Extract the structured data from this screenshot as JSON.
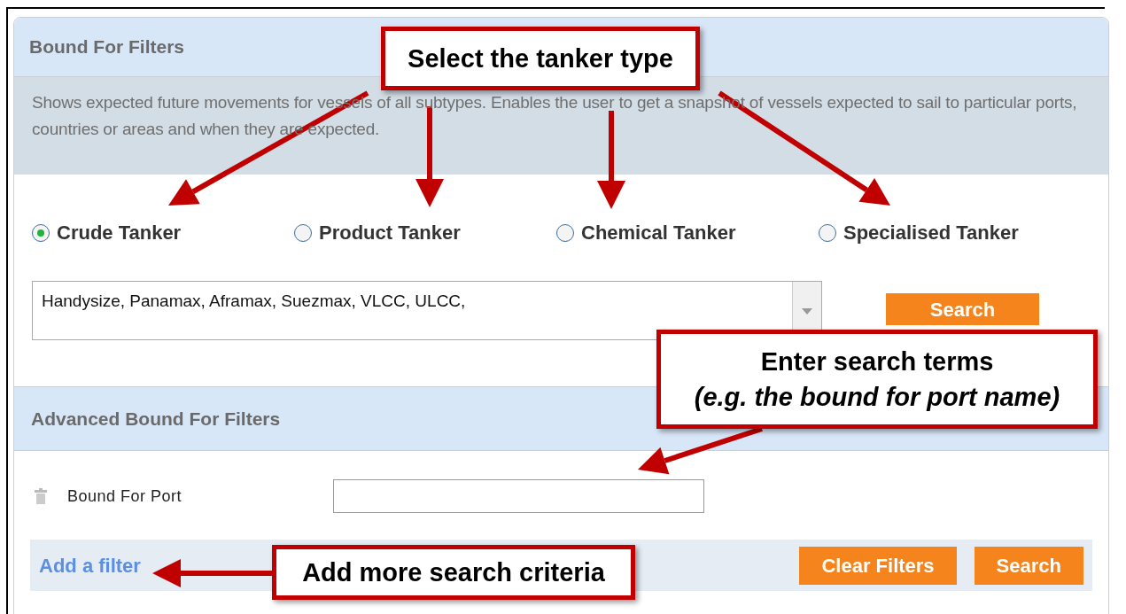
{
  "panel": {
    "title": "Bound For Filters",
    "description": "Shows expected future movements for vessels of all subtypes. Enables the user to get a snapshot of vessels expected to sail to particular ports, countries or areas and when they are expected.",
    "tanker_types": [
      {
        "label": "Crude Tanker",
        "selected": true
      },
      {
        "label": "Product Tanker",
        "selected": false
      },
      {
        "label": "Chemical Tanker",
        "selected": false
      },
      {
        "label": "Specialised Tanker",
        "selected": false
      }
    ],
    "subtypes_value": "Handysize, Panamax, Aframax, Suezmax, VLCC, ULCC,",
    "search_button": "Search"
  },
  "advanced": {
    "title": "Advanced Bound For Filters",
    "filters": [
      {
        "label": "Bound For Port"
      }
    ],
    "add_filter_link": "Add a filter",
    "buttons": [
      "Clear Filters",
      "Search"
    ]
  },
  "callouts": [
    {
      "kind": "tanker",
      "lines": [
        "Select the tanker type"
      ]
    },
    {
      "kind": "search",
      "lines": [
        "Enter search terms",
        "(e.g. the bound for port name)"
      ]
    },
    {
      "kind": "criteria",
      "lines": [
        "Add more search criteria"
      ]
    }
  ]
}
